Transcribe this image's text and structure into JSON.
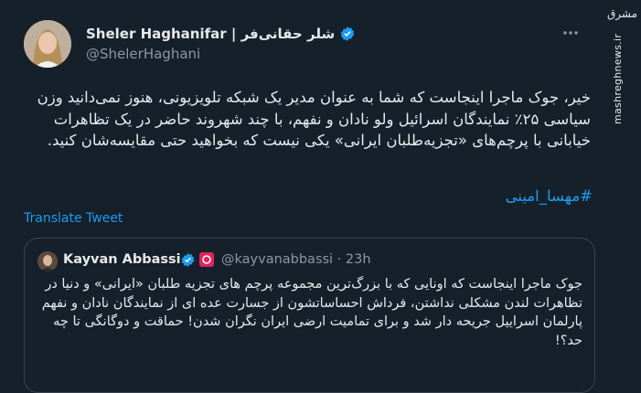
{
  "tweet": {
    "display_name": "Sheler Haghanifar | شلر حقانی‌فر",
    "handle": "@ShelerHaghani",
    "body": "خیر، جوک ماجرا اینجاست که شما به عنوان مدیر یک شبکه تلویزیونی، هنوز نمی‌دانید وزن سیاسی ۲۵٪ نمایندگان اسرائیل ولو نادان و نفهم، با چند شهروند حاضر در یک تظاهرات خیابانی با پرچم‌های «تجزیه‌طلبان ایرانی» یکی نیست که بخواهید حتی مقایسه‌شان کنید.",
    "hashtag": "#مهسا_امینی",
    "translate_label": "Translate Tweet",
    "icons": {
      "verified": "verified-badge-icon",
      "more": "more-icon"
    }
  },
  "quote": {
    "display_name": "Kayvan Abbassi",
    "handle": "@kayvanabbassi · 23h",
    "text": "جوک ماجرا اینجاست که اونایی که با بزرگ‌ترین مجموعه پرچم های تجزیه طلبان «ایرانی» و دنیا در تظاهرات لندن مشکلی نداشتن، فرداش احساساتشون از جسارت عده ای از نمایندگان نادان و نفهم پارلمان اسراییل جریحه دار شد و برای تمامیت ارضی ایران نگران شدن! حماقت و دوگانگی تا چه حد؟!"
  },
  "watermark": {
    "logo": "مشرق",
    "url": "mashreghnews.ir"
  },
  "colors": {
    "background": "#15202b",
    "accent": "#1d9bf0",
    "text": "#e7e9ea",
    "muted": "#8b98a5",
    "border": "#38444d"
  }
}
